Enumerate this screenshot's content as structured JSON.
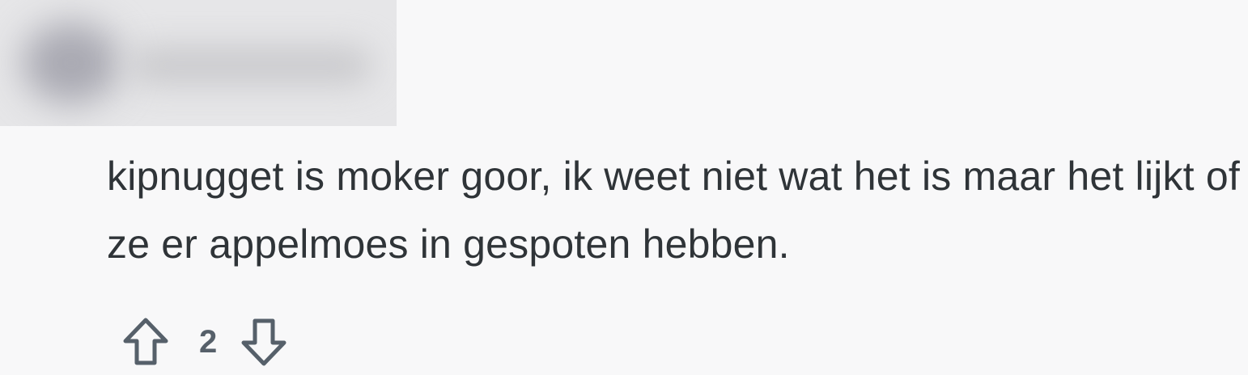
{
  "comment": {
    "author_redacted": true,
    "body": "kipnugget is moker goor, ik weet niet wat het is maar het lijkt of ze er appelmoes in gespoten hebben.",
    "score": "2"
  },
  "icons": {
    "upvote": "upvote-arrow-icon",
    "downvote": "downvote-arrow-icon"
  },
  "colors": {
    "background": "#f8f8f9",
    "text": "#2f3438",
    "icon": "#56606a"
  }
}
